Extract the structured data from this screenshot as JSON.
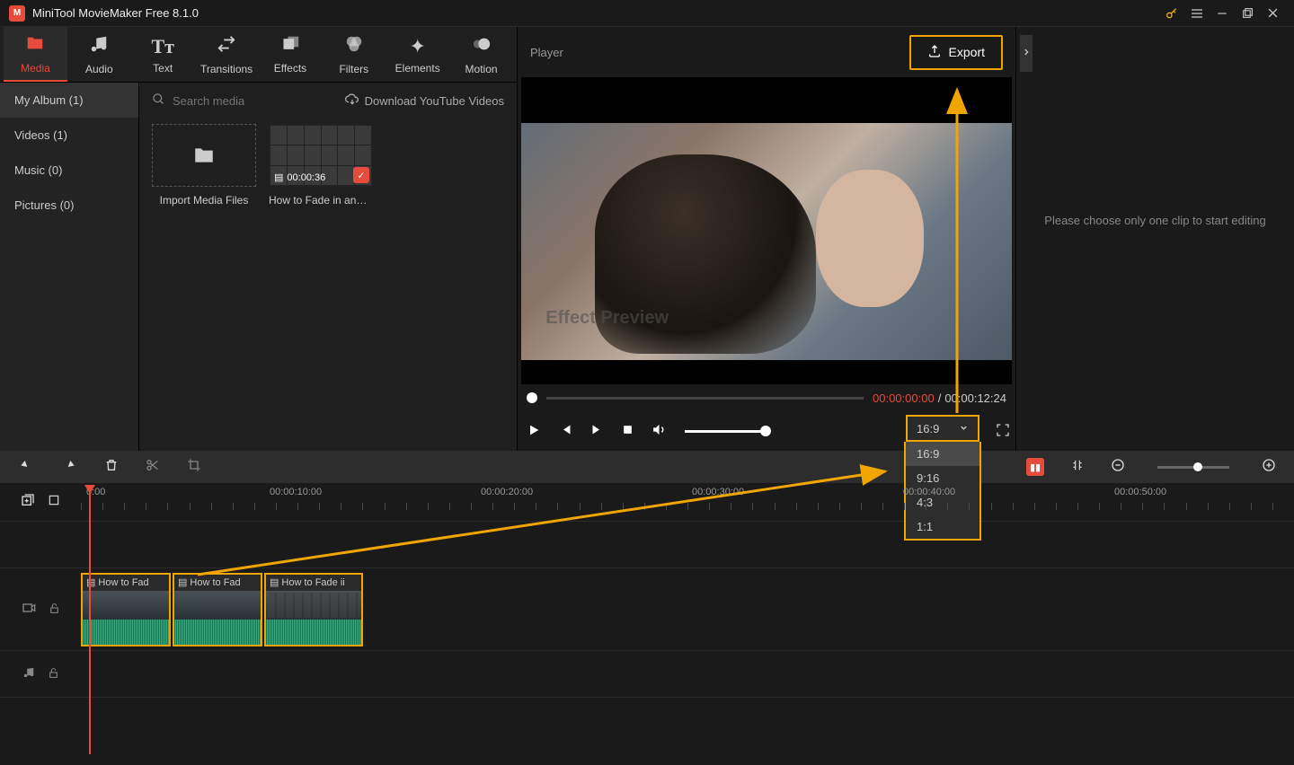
{
  "app": {
    "title": "MiniTool MovieMaker Free 8.1.0"
  },
  "tabs": {
    "media": "Media",
    "audio": "Audio",
    "text": "Text",
    "transitions": "Transitions",
    "effects": "Effects",
    "filters": "Filters",
    "elements": "Elements",
    "motion": "Motion"
  },
  "sidebar": {
    "album": "My Album (1)",
    "videos": "Videos (1)",
    "music": "Music (0)",
    "pictures": "Pictures (0)"
  },
  "mediaHeader": {
    "searchPlaceholder": "Search media",
    "download": "Download YouTube Videos"
  },
  "mediaCards": {
    "import": "Import Media Files",
    "clip1_duration": "00:00:36",
    "clip1_label": "How to Fade in and…"
  },
  "player": {
    "label": "Player",
    "export": "Export",
    "effectPreview": "Effect Preview",
    "timeNow": "00:00:00:00",
    "timeSep": " / ",
    "timeTotal": "00:00:12:24"
  },
  "aspect": {
    "current": "16:9",
    "opt1": "16:9",
    "opt2": "9:16",
    "opt3": "4:3",
    "opt4": "1:1"
  },
  "rightPane": {
    "placeholder": "Please choose only one clip to start editing"
  },
  "ruler": {
    "t0": "0:00",
    "t1": "00:00:10:00",
    "t2": "00:00:20:00",
    "t3": "00:00:30:00",
    "t4": "00:00:40:00",
    "t5": "00:00:50:00"
  },
  "clips": {
    "c1": "How to Fad",
    "c2": "How to Fad",
    "c3": "How to Fade ii"
  }
}
